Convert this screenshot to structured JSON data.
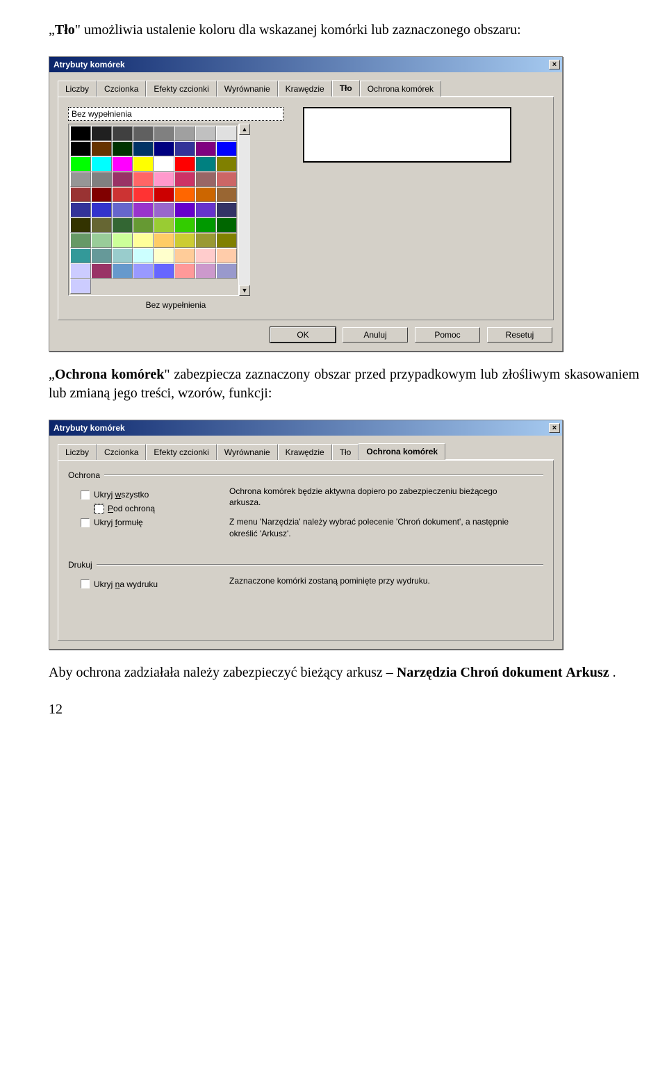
{
  "intro1_prefix": "„",
  "intro1_bold": "Tło",
  "intro1_rest": "\" umożliwia ustalenie koloru dla wskazanej komórki lub zaznaczonego obszaru:",
  "dlg1": {
    "title": "Atrybuty komórek",
    "close": "×",
    "tabs": [
      "Liczby",
      "Czcionka",
      "Efekty czcionki",
      "Wyrównanie",
      "Krawędzie",
      "Tło",
      "Ochrona komórek"
    ],
    "active_tab": "Tło",
    "nofill": "Bez wypełnienia",
    "caption": "Bez wypełnienia",
    "buttons": [
      "OK",
      "Anuluj",
      "Pomoc",
      "Resetuj"
    ],
    "scroll_up": "▲",
    "scroll_down": "▼"
  },
  "colors": [
    [
      "#000000",
      "#202020",
      "#404040",
      "#606060",
      "#808080",
      "#a0a0a0",
      "#c0c0c0",
      "#e0e0e0"
    ],
    [
      "#000000",
      "#663300",
      "#003300",
      "#003366",
      "#000080",
      "#333399",
      "#800080",
      "#0000ff"
    ],
    [
      "#00ff00",
      "#00ffff",
      "#ff00ff",
      "#ffff00",
      "#ffffff",
      "#ff0000",
      "#008080",
      "#808000"
    ],
    [
      "#969696",
      "#808080",
      "#993366",
      "#ff6666",
      "#ff99cc",
      "#cc3366",
      "#996666",
      "#cc6666"
    ],
    [
      "#993333",
      "#800000",
      "#cc3333",
      "#ff3333",
      "#cc0000",
      "#ff6600",
      "#cc6600",
      "#996633"
    ],
    [
      "#333399",
      "#3333cc",
      "#6666cc",
      "#9933cc",
      "#9966cc",
      "#6600cc",
      "#6633cc",
      "#333366"
    ],
    [
      "#333300",
      "#666633",
      "#336633",
      "#669933",
      "#99cc33",
      "#33cc00",
      "#009900",
      "#006600"
    ],
    [
      "#669966",
      "#99cc99",
      "#ccff99",
      "#ffff99",
      "#ffcc66",
      "#cccc33",
      "#999933",
      "#808000"
    ],
    [
      "#339999",
      "#669999",
      "#99cccc",
      "#ccffff",
      "#ffffcc",
      "#ffcc99",
      "#ffcccc",
      "#ffccaa"
    ],
    [
      "#ccccff",
      "#993366",
      "#6699cc",
      "#9999ff",
      "#6666ff",
      "#ff9999",
      "#cc99cc",
      "#9999cc"
    ]
  ],
  "last_row_count": 1,
  "last_row_color": "#ccccff",
  "intro2_prefix": "„",
  "intro2_bold": "Ochrona komórek",
  "intro2_rest": "\" zabezpiecza zaznaczony obszar przed przypadkowym lub złośliwym  skasowaniem lub zmianą jego treści, wzorów, funkcji:",
  "dlg2": {
    "title": "Atrybuty komórek",
    "close": "×",
    "tabs": [
      "Liczby",
      "Czcionka",
      "Efekty czcionki",
      "Wyrównanie",
      "Krawędzie",
      "Tło",
      "Ochrona komórek"
    ],
    "active_tab": "Ochrona komórek",
    "group1": "Ochrona",
    "chk1": "Ukryj wszystko",
    "chk1_u": "w",
    "chk2": "Pod ochroną",
    "chk2_u": "P",
    "chk3": "Ukryj formułę",
    "chk3_u": "f",
    "info1": "Ochrona komórek będzie aktywna dopiero po zabezpieczeniu bieżącego arkusza.",
    "info2": "Z menu 'Narzędzia' należy wybrać polecenie 'Chroń dokument', a następnie określić 'Arkusz'.",
    "group2": "Drukuj",
    "chk4_pre": "Ukryj ",
    "chk4_u": "n",
    "chk4_post": "a wydruku",
    "info3": "Zaznaczone komórki zostaną pominięte przy wydruku."
  },
  "outro_pre": "Aby ochrona zadziałała należy zabezpieczyć bieżący arkusz – ",
  "outro_b1": "Narzędzia",
  "outro_mid": "  ",
  "outro_b2": "Chroń dokument",
  "outro_mid2": " ",
  "outro_b3": "Arkusz",
  "outro_end": " .",
  "page": "12"
}
